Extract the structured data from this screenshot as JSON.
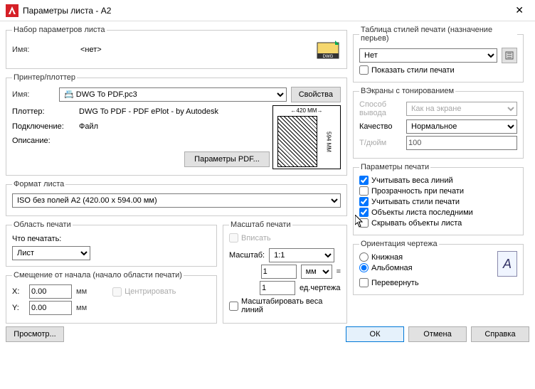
{
  "window": {
    "title": "Параметры листа - A2",
    "close": "✕"
  },
  "pageset": {
    "legend": "Набор параметров листа",
    "name_label": "Имя:",
    "name_value": "<нет>"
  },
  "printer": {
    "legend": "Принтер/плоттер",
    "name_label": "Имя:",
    "name_value": "📇 DWG To PDF.pc3",
    "props_btn": "Свойства",
    "plotter_label": "Плоттер:",
    "plotter_value": "DWG To PDF - PDF ePlot - by Autodesk",
    "conn_label": "Подключение:",
    "conn_value": "Файл",
    "desc_label": "Описание:",
    "pdf_btn": "Параметры PDF...",
    "preview_w": "420 MM",
    "preview_h": "594 MM"
  },
  "paper": {
    "legend": "Формат листа",
    "value": "ISO без полей A2 (420.00 x 594.00 мм)"
  },
  "plotarea": {
    "legend": "Область печати",
    "what_label": "Что печатать:",
    "what_value": "Лист"
  },
  "offset": {
    "legend": "Смещение от начала (начало области печати)",
    "x_label": "X:",
    "x_value": "0.00",
    "x_unit": "мм",
    "y_label": "Y:",
    "y_value": "0.00",
    "y_unit": "мм",
    "center": "Центрировать"
  },
  "scale": {
    "legend": "Масштаб печати",
    "fit": "Вписать",
    "scale_label": "Масштаб:",
    "scale_value": "1:1",
    "num": "1",
    "unit_value": "мм",
    "equals": "=",
    "den": "1",
    "den_unit": "ед.чертежа",
    "lineweights": "Масштабировать веса линий"
  },
  "styles": {
    "legend": "Таблица стилей печати (назначение перьев)",
    "value": "Нет",
    "show": "Показать стили печати"
  },
  "shaded": {
    "legend": "ВЭкраны с тонированием",
    "mode_label": "Способ вывода",
    "mode_value": "Как на экране",
    "quality_label": "Качество",
    "quality_value": "Нормальное",
    "dpi_label": "Т/дюйм",
    "dpi_value": "100"
  },
  "options": {
    "legend": "Параметры печати",
    "lineweights": "Учитывать веса линий",
    "transparency": "Прозрачность при печати",
    "plotstyles": "Учитывать стили печати",
    "paperspace_last": "Объекты листа последними",
    "hide": "Скрывать объекты листа"
  },
  "orient": {
    "legend": "Ориентация чертежа",
    "portrait": "Книжная",
    "landscape": "Альбомная",
    "upside": "Перевернуть"
  },
  "footer": {
    "preview": "Просмотр...",
    "ok": "ОК",
    "cancel": "Отмена",
    "help": "Справка"
  }
}
